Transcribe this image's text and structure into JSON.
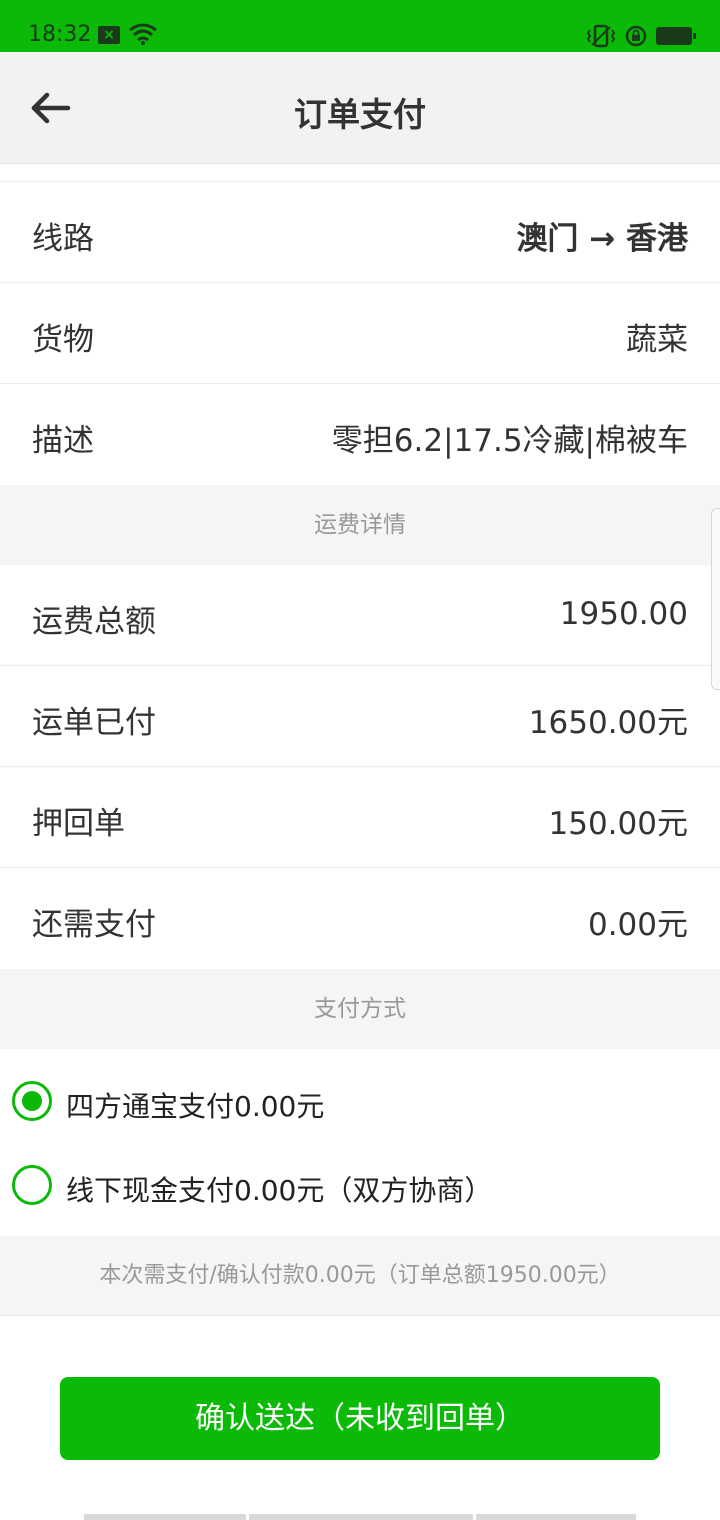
{
  "status_bar": {
    "time": "18:32",
    "mail_icon": "mail-icon",
    "wifi_icon": "wifi-icon",
    "vibrate_icon": "vibrate-icon",
    "lock_icon": "rotation-lock-icon",
    "battery_icon": "battery-icon"
  },
  "header": {
    "title": "订单支付",
    "back_icon": "arrow-left-icon"
  },
  "details": [
    {
      "label": "线路",
      "value": "澳门 → 香港"
    },
    {
      "label": "货物",
      "value": "蔬菜"
    },
    {
      "label": "描述",
      "value": "零担6.2|17.5冷藏|棉被车"
    }
  ],
  "freight_section": {
    "title": "运费详情",
    "rows": [
      {
        "label": "运费总额",
        "value": "1950.00"
      },
      {
        "label": "运单已付",
        "value": "1650.00元"
      },
      {
        "label": "押回单",
        "value": "150.00元"
      },
      {
        "label": "还需支付",
        "value": "0.00元"
      }
    ]
  },
  "payment_section": {
    "title": "支付方式",
    "options": [
      {
        "label": "四方通宝支付0.00元",
        "selected": true
      },
      {
        "label": "线下现金支付0.00元（双方协商）",
        "selected": false
      }
    ]
  },
  "summary": "本次需支付/确认付款0.00元（订单总额1950.00元）",
  "confirm_button": "确认送达（未收到回单）",
  "colors": {
    "accent": "#0aba07",
    "background": "#ffffff",
    "section_bg": "#f5f5f5"
  }
}
